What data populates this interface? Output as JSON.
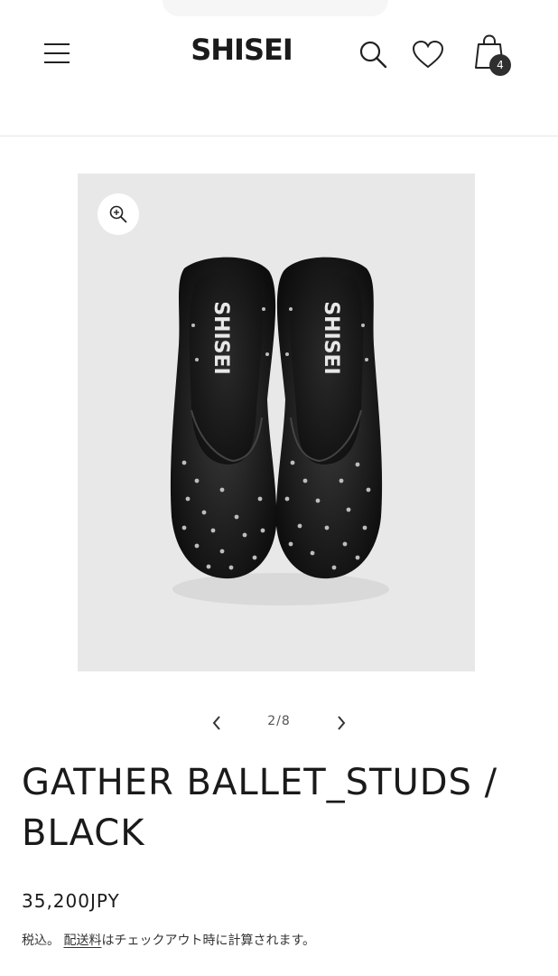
{
  "header": {
    "brand": "SHISEI",
    "icons": [
      "menu-icon",
      "search-icon",
      "heart-icon",
      "cart-icon"
    ],
    "cart_count": "4"
  },
  "gallery": {
    "counter": "2/8",
    "shoe_brand_mark": "SHISEI"
  },
  "product": {
    "title": "GATHER BALLET_STUDS / BLACK",
    "price": "35,200JPY",
    "tax_prefix": "税込。",
    "shipping_link": "配送料",
    "tax_suffix": "はチェックアウト時に計算されます。"
  },
  "colors": {
    "background": "#ffffff",
    "media_bg": "#e8e8e8",
    "badge": "#2f2f2f",
    "text": "#121212"
  }
}
